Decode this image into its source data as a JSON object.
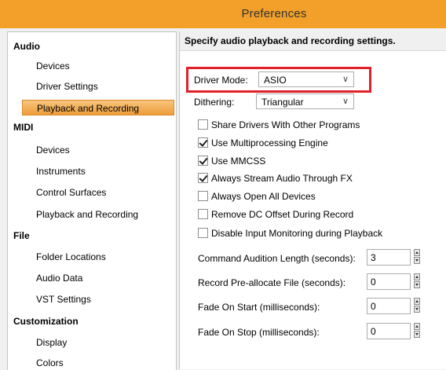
{
  "window": {
    "title": "Preferences"
  },
  "sidebar": {
    "categories": [
      {
        "label": "Audio",
        "items": [
          "Devices",
          "Driver Settings",
          "Playback and Recording"
        ]
      },
      {
        "label": "MIDI",
        "items": [
          "Devices",
          "Instruments",
          "Control Surfaces",
          "Playback and Recording"
        ]
      },
      {
        "label": "File",
        "items": [
          "Folder Locations",
          "Audio Data",
          "VST Settings"
        ]
      },
      {
        "label": "Customization",
        "items": [
          "Display",
          "Colors"
        ]
      }
    ],
    "selected": "Audio / Playback and Recording"
  },
  "main": {
    "header": "Specify audio playback and recording settings.",
    "driver_mode": {
      "label": "Driver Mode:",
      "value": "ASIO"
    },
    "dithering": {
      "label": "Dithering:",
      "value": "Triangular"
    },
    "checkboxes": [
      {
        "label": "Share Drivers With Other Programs",
        "checked": false
      },
      {
        "label": "Use Multiprocessing Engine",
        "checked": true
      },
      {
        "label": "Use MMCSS",
        "checked": true
      },
      {
        "label": "Always Stream Audio Through FX",
        "checked": true
      },
      {
        "label": "Always Open All Devices",
        "checked": false
      },
      {
        "label": "Remove DC Offset During Record",
        "checked": false
      },
      {
        "label": "Disable Input Monitoring during Playback",
        "checked": false
      }
    ],
    "numeric_fields": [
      {
        "label": "Command Audition Length (seconds):",
        "value": "3"
      },
      {
        "label": "Record Pre-allocate File (seconds):",
        "value": "0"
      },
      {
        "label": "Fade On Start  (milliseconds):",
        "value": "0"
      },
      {
        "label": "Fade On Stop  (milliseconds):",
        "value": "0"
      }
    ]
  },
  "colors": {
    "title_bar": "#f2a02a",
    "selection": "#ee9c3a",
    "highlight_box": "#e0202a"
  }
}
